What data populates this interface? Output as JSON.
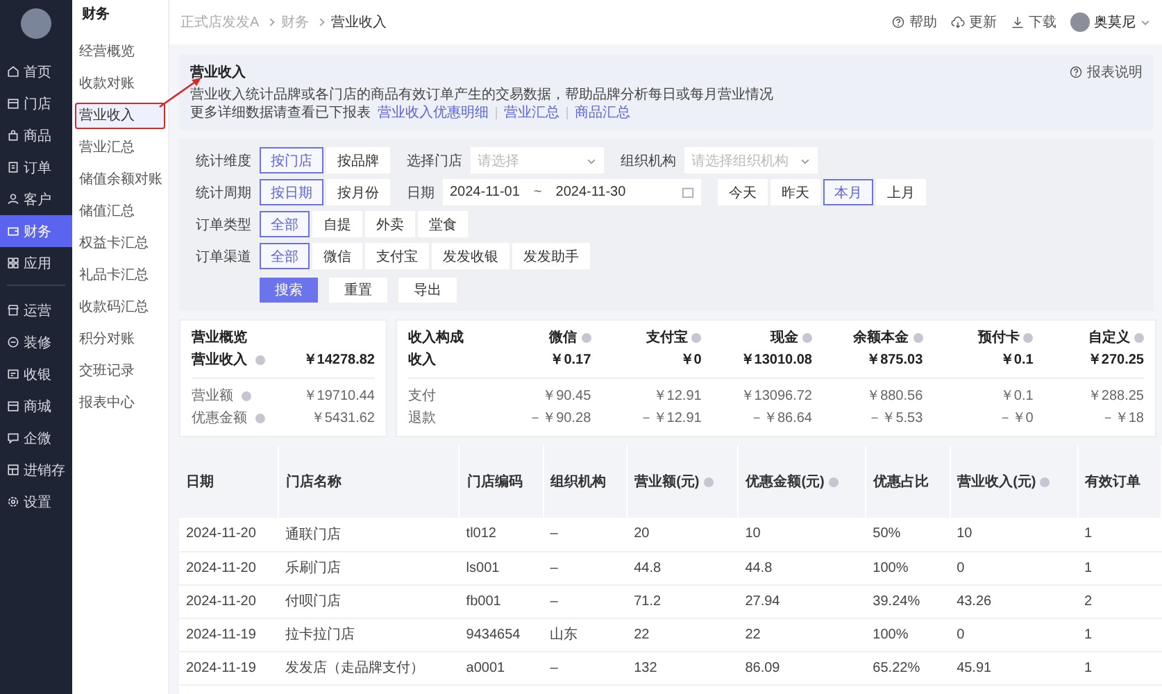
{
  "nav_rail": {
    "groups": [
      [
        {
          "label": "首页",
          "selected": false
        },
        {
          "label": "门店",
          "selected": false
        },
        {
          "label": "商品",
          "selected": false
        },
        {
          "label": "订单",
          "selected": false
        },
        {
          "label": "客户",
          "selected": false
        },
        {
          "label": "财务",
          "selected": true
        },
        {
          "label": "应用",
          "selected": false
        }
      ],
      [
        {
          "label": "运营",
          "selected": false
        },
        {
          "label": "装修",
          "selected": false
        },
        {
          "label": "收银",
          "selected": false
        },
        {
          "label": "商城",
          "selected": false
        },
        {
          "label": "企微",
          "selected": false
        },
        {
          "label": "进销存",
          "selected": false
        },
        {
          "label": "设置",
          "selected": false
        }
      ]
    ]
  },
  "submenu": {
    "title": "财务",
    "items": [
      {
        "label": "经营概览",
        "selected": false,
        "annotated": false
      },
      {
        "label": "收款对账",
        "selected": false,
        "annotated": false
      },
      {
        "label": "营业收入",
        "selected": true,
        "annotated": true
      },
      {
        "label": "营业汇总",
        "selected": false,
        "annotated": false
      },
      {
        "label": "储值余额对账",
        "selected": false,
        "annotated": false
      },
      {
        "label": "储值汇总",
        "selected": false,
        "annotated": false
      },
      {
        "label": "权益卡汇总",
        "selected": false,
        "annotated": false
      },
      {
        "label": "礼品卡汇总",
        "selected": false,
        "annotated": false
      },
      {
        "label": "收款码汇总",
        "selected": false,
        "annotated": false
      },
      {
        "label": "积分对账",
        "selected": false,
        "annotated": false
      },
      {
        "label": "交班记录",
        "selected": false,
        "annotated": false
      },
      {
        "label": "报表中心",
        "selected": false,
        "annotated": false
      }
    ]
  },
  "header": {
    "breadcrumb": [
      "正式店发发A",
      "财务",
      "营业收入"
    ],
    "actions": [
      {
        "label": "帮助"
      },
      {
        "label": "更新"
      },
      {
        "label": "下载"
      }
    ],
    "user": {
      "name": "奥莫尼"
    }
  },
  "info": {
    "title": "营业收入",
    "description": "营业收入统计品牌或各门店的商品有效订单产生的交易数据，帮助品牌分析每日或每月营业情况",
    "more_text": "更多详细数据请查看已下报表",
    "links": [
      "营业收入优惠明细",
      "营业汇总",
      "商品汇总"
    ],
    "help_link": "报表说明"
  },
  "filters": {
    "rows": [
      {
        "items": [
          {
            "kind": "segmented",
            "label": "统计维度",
            "options": [
              {
                "label": "按门店",
                "selected": true
              },
              {
                "label": "按品牌",
                "selected": false
              }
            ]
          },
          {
            "kind": "select",
            "label": "选择门店",
            "placeholder": "请选择"
          },
          {
            "kind": "select",
            "label": "组织机构",
            "placeholder": "请选择组织机构"
          }
        ]
      },
      {
        "items": [
          {
            "kind": "segmented",
            "label": "统计周期",
            "options": [
              {
                "label": "按日期",
                "selected": true
              },
              {
                "label": "按月份",
                "selected": false
              }
            ]
          },
          {
            "kind": "date_range",
            "label": "日期",
            "start": "2024-11-01",
            "separator": "~",
            "end": "2024-11-30"
          },
          {
            "kind": "segmented",
            "options": [
              {
                "label": "今天",
                "selected": false
              },
              {
                "label": "昨天",
                "selected": false
              },
              {
                "label": "本月",
                "selected": true
              },
              {
                "label": "上月",
                "selected": false
              }
            ]
          }
        ]
      },
      {
        "items": [
          {
            "kind": "segmented",
            "label": "订单类型",
            "options": [
              {
                "label": "全部",
                "selected": true
              },
              {
                "label": "自提",
                "selected": false
              },
              {
                "label": "外卖",
                "selected": false
              },
              {
                "label": "堂食",
                "selected": false
              }
            ]
          }
        ]
      },
      {
        "items": [
          {
            "kind": "segmented",
            "label": "订单渠道",
            "options": [
              {
                "label": "全部",
                "selected": true
              },
              {
                "label": "微信",
                "selected": false
              },
              {
                "label": "支付宝",
                "selected": false
              },
              {
                "label": "发发收银",
                "selected": false
              },
              {
                "label": "发发助手",
                "selected": false
              }
            ]
          }
        ]
      }
    ],
    "buttons": [
      {
        "label": "搜索",
        "kind": "primary"
      },
      {
        "label": "重置",
        "kind": "default"
      },
      {
        "label": "导出",
        "kind": "default"
      }
    ]
  },
  "overview": {
    "title": "营业概览",
    "main": {
      "label": "营业收入",
      "value": "￥14278.82"
    },
    "rows": [
      {
        "label": "营业额",
        "value": "￥19710.44"
      },
      {
        "label": "优惠金额",
        "value": "￥5431.62"
      }
    ]
  },
  "composition": {
    "headers": [
      {
        "label": "收入构成",
        "info": false
      },
      {
        "label": "微信",
        "info": true
      },
      {
        "label": "支付宝",
        "info": true
      },
      {
        "label": "现金",
        "info": true
      },
      {
        "label": "余额本金",
        "info": true
      },
      {
        "label": "预付卡",
        "info": true
      },
      {
        "label": "自定义",
        "info": true
      }
    ],
    "main": {
      "label": "收入",
      "values": [
        "￥0.17",
        "￥0",
        "￥13010.08",
        "￥875.03",
        "￥0.1",
        "￥270.25"
      ]
    },
    "rows": [
      {
        "label": "支付",
        "values": [
          "￥90.45",
          "￥12.91",
          "￥13096.72",
          "￥880.56",
          "￥0.1",
          "￥288.25"
        ]
      },
      {
        "label": "退款",
        "values": [
          "－￥90.28",
          "－￥12.91",
          "－￥86.64",
          "－￥5.53",
          "－￥0",
          "－￥18"
        ]
      }
    ]
  },
  "table": {
    "columns": [
      {
        "label": "日期",
        "info": false
      },
      {
        "label": "门店名称",
        "info": false
      },
      {
        "label": "门店编码",
        "info": false
      },
      {
        "label": "组织机构",
        "info": false
      },
      {
        "label": "营业额(元)",
        "info": true
      },
      {
        "label": "优惠金额(元)",
        "info": true
      },
      {
        "label": "优惠占比",
        "info": false
      },
      {
        "label": "营业收入(元)",
        "info": true
      },
      {
        "label": "有效订单",
        "info": false
      }
    ],
    "rows": [
      [
        "2024-11-20",
        "通联门店",
        "tl012",
        "–",
        "20",
        "10",
        "50%",
        "10",
        "1"
      ],
      [
        "2024-11-20",
        "乐刷门店",
        "ls001",
        "–",
        "44.8",
        "44.8",
        "100%",
        "0",
        "1"
      ],
      [
        "2024-11-20",
        "付呗门店",
        "fb001",
        "–",
        "71.2",
        "27.94",
        "39.24%",
        "43.26",
        "2"
      ],
      [
        "2024-11-19",
        "拉卡拉门店",
        "9434654",
        "山东",
        "22",
        "22",
        "100%",
        "0",
        "1"
      ],
      [
        "2024-11-19",
        "发发店（走品牌支付）",
        "a0001",
        "–",
        "132",
        "86.09",
        "65.22%",
        "45.91",
        "1"
      ]
    ]
  }
}
